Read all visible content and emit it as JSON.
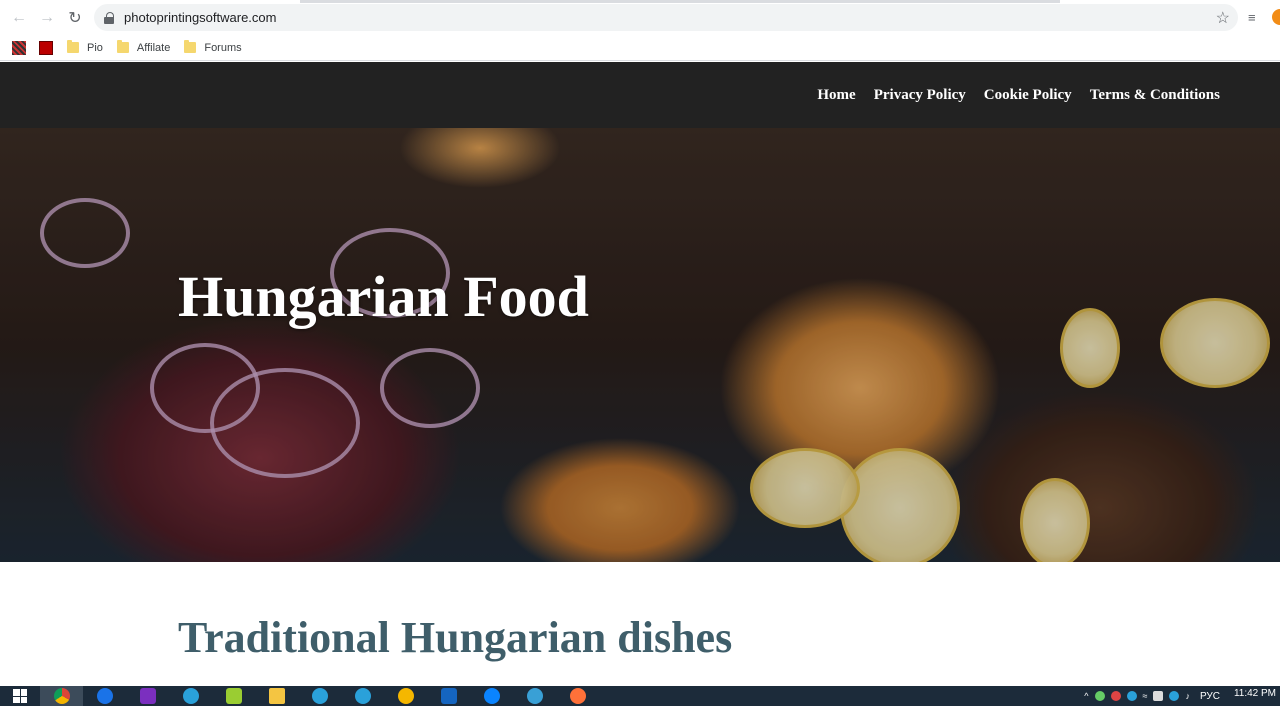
{
  "browser": {
    "url": "photoprintingsoftware.com",
    "bookmarks": [
      {
        "label": ""
      },
      {
        "label": ""
      },
      {
        "label": "Pio"
      },
      {
        "label": "Affilate"
      },
      {
        "label": "Forums"
      }
    ]
  },
  "site": {
    "nav": [
      "Home",
      "Privacy Policy",
      "Cookie Policy",
      "Terms & Conditions"
    ],
    "hero_title": "Hungarian Food",
    "section_title": "Traditional Hungarian dishes"
  },
  "taskbar": {
    "lang": "РУС",
    "time": "11:42 PM",
    "apps": [
      "chrome-icon",
      "browser-icon",
      "purple-app-icon",
      "telegram-icon",
      "android-icon",
      "file-explorer-icon",
      "telegram-icon",
      "telegram-icon",
      "dollar-icon",
      "mail-icon",
      "edge-icon",
      "settings-icon",
      "firefox-icon"
    ]
  },
  "colors": {
    "header_bg": "#222222",
    "section_title": "#3f5e6a",
    "taskbar_bg": "#1c2b3a"
  }
}
